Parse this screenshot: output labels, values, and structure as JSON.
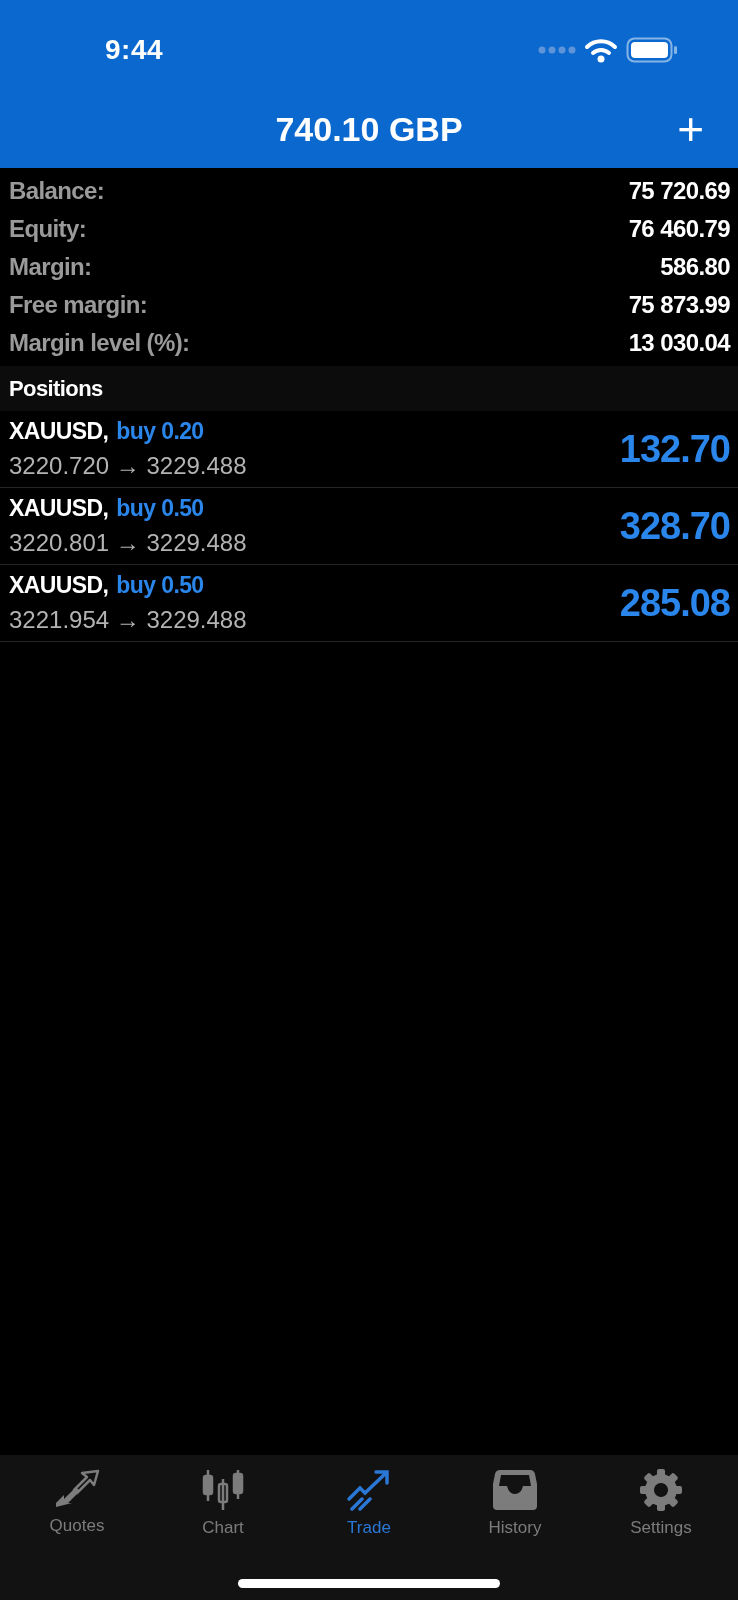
{
  "status_bar": {
    "time": "9:44"
  },
  "header": {
    "title": "740.10 GBP",
    "add_button": "+"
  },
  "summary": [
    {
      "label": "Balance:",
      "value": "75 720.69"
    },
    {
      "label": "Equity:",
      "value": "76 460.79"
    },
    {
      "label": "Margin:",
      "value": "586.80"
    },
    {
      "label": "Free margin:",
      "value": "75 873.99"
    },
    {
      "label": "Margin level (%):",
      "value": "13 030.04"
    }
  ],
  "positions": {
    "heading": "Positions",
    "rows": [
      {
        "symbol": "XAUUSD,",
        "side": "buy 0.20",
        "prices": "3220.720 → 3229.488",
        "profit": "132.70"
      },
      {
        "symbol": "XAUUSD,",
        "side": "buy 0.50",
        "prices": "3220.801 → 3229.488",
        "profit": "328.70"
      },
      {
        "symbol": "XAUUSD,",
        "side": "buy 0.50",
        "prices": "3221.954 → 3229.488",
        "profit": "285.08"
      }
    ]
  },
  "tabs": [
    {
      "kind": "quotes",
      "label": "Quotes",
      "selected": false
    },
    {
      "kind": "chart",
      "label": "Chart",
      "selected": false
    },
    {
      "kind": "trade",
      "label": "Trade",
      "selected": true
    },
    {
      "kind": "history",
      "label": "History",
      "selected": false
    },
    {
      "kind": "settings",
      "label": "Settings",
      "selected": false
    }
  ]
}
